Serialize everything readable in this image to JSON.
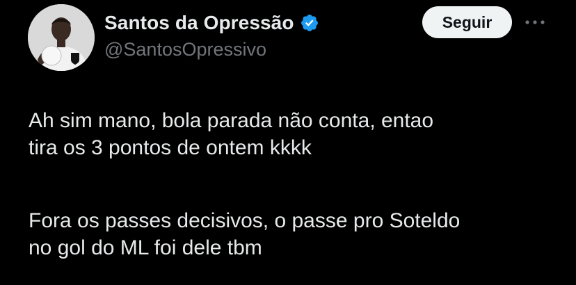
{
  "user": {
    "display_name": "Santos da Opressão",
    "handle": "@SantosOpressivo",
    "verified": true,
    "verified_color": "#1d9bf0"
  },
  "actions": {
    "follow_label": "Seguir",
    "more_icon": "more-horizontal-icon"
  },
  "tweet": {
    "paragraph1_line1": "Ah sim mano, bola parada não conta, entao",
    "paragraph1_line2": "tira os 3 pontos de ontem kkkk",
    "paragraph2_line1": "Fora os passes decisivos, o passe pro Soteldo",
    "paragraph2_line2": "no gol do ML foi dele tbm"
  },
  "colors": {
    "background": "#000000",
    "text": "#e7e9ea",
    "secondary_text": "#71767b",
    "button_bg": "#eff3f4",
    "button_text": "#0f1419"
  }
}
